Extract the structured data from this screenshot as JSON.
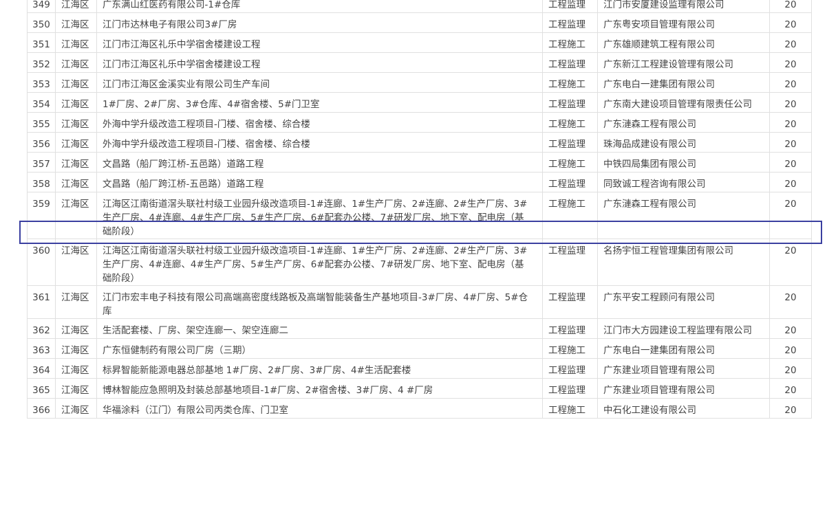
{
  "table": {
    "rows": [
      {
        "no": "349",
        "district": "江海区",
        "project": "广东满山红医药有限公司-1#仓库",
        "type": "工程监理",
        "company": "江门市安厦建设监理有限公司",
        "score": "20"
      },
      {
        "no": "350",
        "district": "江海区",
        "project": "江门市达林电子有限公司3#厂房",
        "type": "工程监理",
        "company": "广东粤安项目管理有限公司",
        "score": "20"
      },
      {
        "no": "351",
        "district": "江海区",
        "project": "江门市江海区礼乐中学宿舍楼建设工程",
        "type": "工程施工",
        "company": "广东雄顺建筑工程有限公司",
        "score": "20"
      },
      {
        "no": "352",
        "district": "江海区",
        "project": "江门市江海区礼乐中学宿舍楼建设工程",
        "type": "工程监理",
        "company": "广东新江工程建设管理有限公司",
        "score": "20"
      },
      {
        "no": "353",
        "district": "江海区",
        "project": "江门市江海区金溪实业有限公司生产车间",
        "type": "工程施工",
        "company": "广东电白一建集团有限公司",
        "score": "20"
      },
      {
        "no": "354",
        "district": "江海区",
        "project": "1#厂房、2#厂房、3#仓库、4#宿舍楼、5#门卫室",
        "type": "工程监理",
        "company": "广东南大建设项目管理有限责任公司",
        "score": "20"
      },
      {
        "no": "355",
        "district": "江海区",
        "project": "外海中学升级改造工程项目-门楼、宿舍楼、综合楼",
        "type": "工程施工",
        "company": "广东漣森工程有限公司",
        "score": "20"
      },
      {
        "no": "356",
        "district": "江海区",
        "project": "外海中学升级改造工程项目-门楼、宿舍楼、综合楼",
        "type": "工程监理",
        "company": "珠海品成建设有限公司",
        "score": "20"
      },
      {
        "no": "357",
        "district": "江海区",
        "project": "文昌路（船厂跨江桥-五邑路）道路工程",
        "type": "工程施工",
        "company": "中铁四局集团有限公司",
        "score": "20"
      },
      {
        "no": "358",
        "district": "江海区",
        "project": "文昌路（船厂跨江桥-五邑路）道路工程",
        "type": "工程监理",
        "company": "同致诚工程咨询有限公司",
        "score": "20"
      },
      {
        "no": "359",
        "district": "江海区",
        "project": "江海区江南街道滘头联社村级工业园升级改造项目-1#连廊、1#生产厂房、2#连廊、2#生产厂房、3#生产厂房、4#连廊、4#生产厂房、5#生产厂房、6#配套办公楼、7#研发厂房、地下室、配电房（基础阶段）",
        "type": "工程施工",
        "company": "广东漣森工程有限公司",
        "score": "20"
      },
      {
        "no": "360",
        "district": "江海区",
        "project": "江海区江南街道滘头联社村级工业园升级改造项目-1#连廊、1#生产厂房、2#连廊、2#生产厂房、3#生产厂房、4#连廊、4#生产厂房、5#生产厂房、6#配套办公楼、7#研发厂房、地下室、配电房（基础阶段）",
        "type": "工程监理",
        "company": "名扬宇恒工程管理集团有限公司",
        "score": "20"
      },
      {
        "no": "361",
        "district": "江海区",
        "project": "江门市宏丰电子科技有限公司高端高密度线路板及高端智能装备生产基地项目-3#厂房、4#厂房、5#仓库",
        "type": "工程监理",
        "company": "广东平安工程顾问有限公司",
        "score": "20"
      },
      {
        "no": "362",
        "district": "江海区",
        "project": "生活配套楼、厂房、架空连廊一、架空连廊二",
        "type": "工程监理",
        "company": "江门市大方园建设工程监理有限公司",
        "score": "20"
      },
      {
        "no": "363",
        "district": "江海区",
        "project": "广东恒健制药有限公司厂房（三期）",
        "type": "工程施工",
        "company": "广东电白一建集团有限公司",
        "score": "20"
      },
      {
        "no": "364",
        "district": "江海区",
        "project": "标昇智能新能源电器总部基地 1#厂房、2#厂房、3#厂房、4#生活配套楼",
        "type": "工程监理",
        "company": "广东建业项目管理有限公司",
        "score": "20"
      },
      {
        "no": "365",
        "district": "江海区",
        "project": "博林智能应急照明及封装总部基地项目-1#厂房、2#宿舍楼、3#厂房、4 #厂房",
        "type": "工程监理",
        "company": "广东建业项目管理有限公司",
        "score": "20"
      },
      {
        "no": "366",
        "district": "江海区",
        "project": "华福涂料（江门）有限公司丙类仓库、门卫室",
        "type": "工程施工",
        "company": "中石化工建设有限公司",
        "score": "20"
      }
    ],
    "selected_no": "358",
    "colors": {
      "border": "#e0e0e0",
      "highlight": "#3a3fa0",
      "text": "#444444"
    }
  }
}
